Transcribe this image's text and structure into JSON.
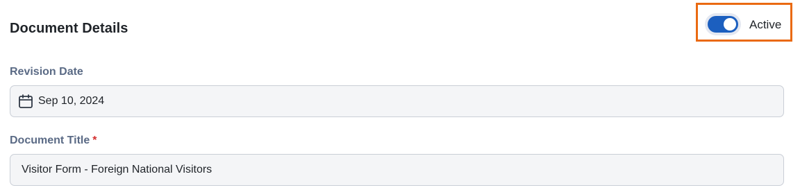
{
  "header": {
    "title": "Document Details"
  },
  "status_toggle": {
    "label": "Active",
    "checked": true,
    "accent_color": "#1c5fbf",
    "highlight_color": "#ea6a12"
  },
  "fields": {
    "revision_date": {
      "label": "Revision Date",
      "value": "Sep 10, 2024",
      "icon": "calendar-icon"
    },
    "document_title": {
      "label": "Document Title",
      "required_marker": "*",
      "value": "Visitor Form - Foreign National Visitors"
    }
  }
}
